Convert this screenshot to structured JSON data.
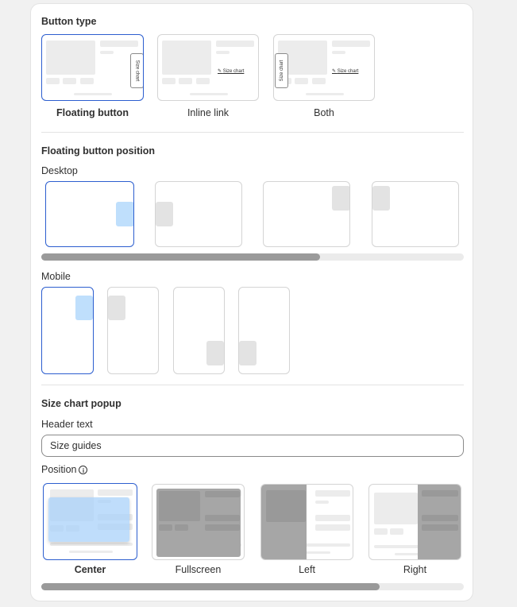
{
  "button_type": {
    "heading": "Button type",
    "options": [
      {
        "label": "Floating button",
        "selected": true
      },
      {
        "label": "Inline link",
        "selected": false
      },
      {
        "label": "Both",
        "selected": false
      }
    ],
    "preview_text": "Size chart"
  },
  "floating_position": {
    "heading": "Floating button position",
    "desktop_label": "Desktop",
    "mobile_label": "Mobile",
    "desktop_scroll_fraction": 0.66,
    "desktop_selected_index": 0,
    "mobile_selected_index": 0
  },
  "size_chart_popup": {
    "heading": "Size chart popup",
    "header_text_label": "Header text",
    "header_text_value": "Size guides",
    "position_label": "Position",
    "info_icon": "i",
    "positions": [
      {
        "label": "Center",
        "selected": true
      },
      {
        "label": "Fullscreen",
        "selected": false
      },
      {
        "label": "Left",
        "selected": false
      },
      {
        "label": "Right",
        "selected": false
      }
    ],
    "scroll_fraction": 0.8
  },
  "colors": {
    "accent": "#2c5ecf",
    "highlight": "#bfdffc"
  }
}
